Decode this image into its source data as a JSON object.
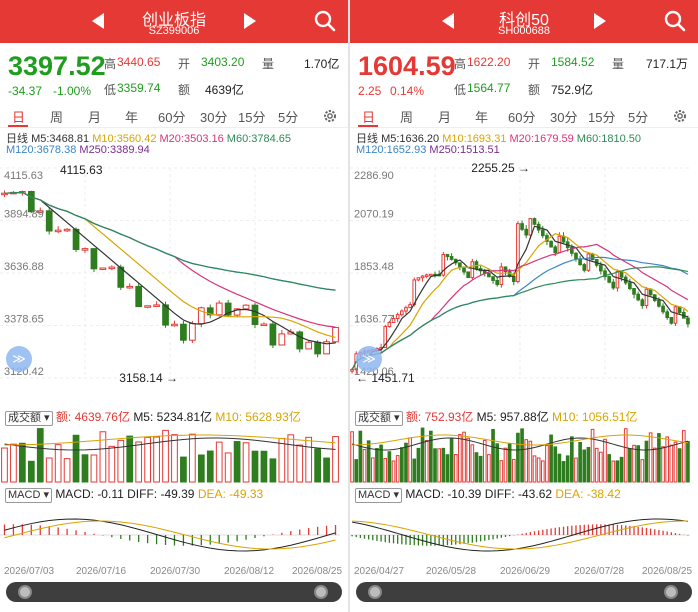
{
  "panels": [
    {
      "name": "创业板指",
      "code": "SZ399006",
      "price": "3397.52",
      "change": "-34.37",
      "pct": "-1.00%",
      "price_color": "green",
      "stats": {
        "high_label": "高",
        "high": "3440.65",
        "open_label": "开",
        "open": "3403.20",
        "vol_label": "量",
        "vol": "1.70亿",
        "low_label": "低",
        "low": "3359.74",
        "amt_label": "额",
        "amt": "4639亿"
      },
      "tabs": [
        "日",
        "周",
        "月",
        "年",
        "60分",
        "30分",
        "15分",
        "5分"
      ],
      "ma_line1": {
        "k": "日线",
        "m5": "M5:3468.81",
        "m10": "M10:3560.42",
        "m20": "M20:3503.16",
        "m60": "M60:3784.65"
      },
      "ma_line2": {
        "m120": "M120:3678.38",
        "m250": "M250:3389.94"
      },
      "y_ticks": [
        "4115.63",
        "3894.89",
        "3636.88",
        "3378.65",
        "3120.42"
      ],
      "start_date": "2026/07/03",
      "end_date": "2026/08/25",
      "max_label": "4115.63",
      "min_label": "3158.14",
      "vol_hdr": {
        "title": "成交额",
        "v": "额: 4639.76亿",
        "m5": "M5: 5234.81亿",
        "m10": "M10: 5628.93亿"
      },
      "macd_hdr": {
        "title": "MACD",
        "macd": "MACD: -0.11",
        "diff": "DIFF: -49.39",
        "dea": "DEA: -49.33"
      },
      "dates": [
        "2026/07/03",
        "2026/07/16",
        "2026/07/30",
        "2026/08/12",
        "2026/08/25"
      ],
      "chart_data": {
        "type": "candlestick",
        "y_range": [
          3120.42,
          4115.63
        ],
        "highest": 4115.63,
        "lowest": 3158.14
      }
    },
    {
      "name": "科创50",
      "code": "SH000688",
      "price": "1604.59",
      "change": "2.25",
      "pct": "0.14%",
      "price_color": "red",
      "stats": {
        "high_label": "高",
        "high": "1622.20",
        "open_label": "开",
        "open": "1584.52",
        "vol_label": "量",
        "vol": "717.1万",
        "low_label": "低",
        "low": "1564.77",
        "amt_label": "额",
        "amt": "752.9亿"
      },
      "tabs": [
        "日",
        "周",
        "月",
        "年",
        "60分",
        "30分",
        "15分",
        "5分"
      ],
      "ma_line1": {
        "k": "日线",
        "m5": "M5:1636.20",
        "m10": "M10:1693.31",
        "m20": "M20:1679.59",
        "m60": "M60:1810.50"
      },
      "ma_line2": {
        "m120": "M120:1652.93",
        "m250": "M250:1513.51"
      },
      "y_ticks": [
        "2286.90",
        "2070.19",
        "1853.48",
        "1636.77",
        "1420.06"
      ],
      "start_date": "2026/04/27",
      "end_date": "2026/08/25",
      "max_label": "2255.25",
      "min_label": "1451.71",
      "vol_hdr": {
        "title": "成交额",
        "v": "额: 752.93亿",
        "m5": "M5: 957.88亿",
        "m10": "M10: 1056.51亿"
      },
      "macd_hdr": {
        "title": "MACD",
        "macd": "MACD: -10.39",
        "diff": "DIFF: -43.62",
        "dea": "DEA: -38.42"
      },
      "dates": [
        "2026/04/27",
        "2026/05/28",
        "2026/06/29",
        "2026/07/28",
        "2026/08/25"
      ],
      "chart_data": {
        "type": "candlestick",
        "y_range": [
          1420.06,
          2286.9
        ],
        "highest": 2255.25,
        "lowest": 1451.71
      }
    }
  ],
  "colors": {
    "up": "#e53935",
    "down": "#2e7d1f",
    "header": "#e53935"
  }
}
